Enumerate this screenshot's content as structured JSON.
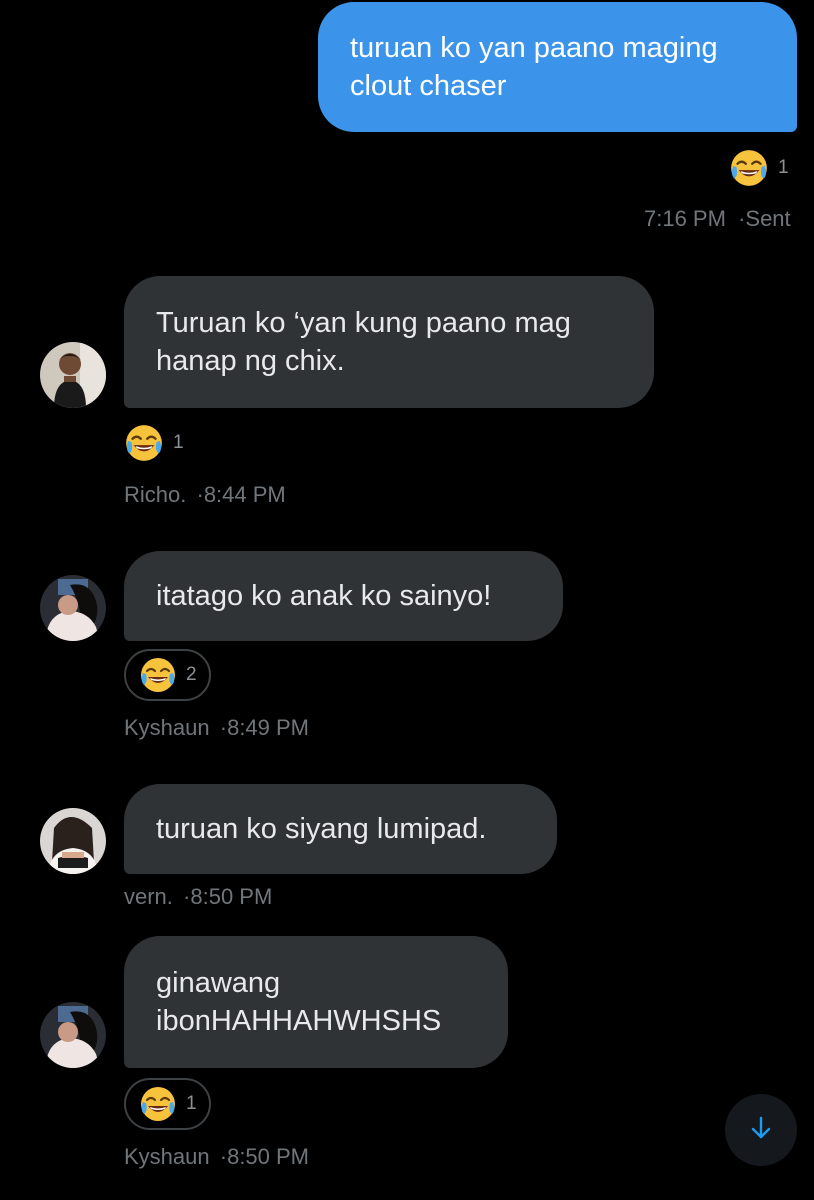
{
  "messages": [
    {
      "text": "turuan ko yan paano maging\nclout chaser",
      "reaction": {
        "emoji": "face-with-tears-of-joy",
        "count": "1"
      },
      "time": "7:16 PM",
      "status": "Sent"
    },
    {
      "text": "Turuan ko ‘yan kung paano mag\nhanap ng chix.",
      "reaction": {
        "emoji": "face-with-tears-of-joy",
        "count": "1"
      },
      "sender": "Richo.",
      "time": "8:44 PM"
    },
    {
      "text": "itatago ko anak ko sainyo!",
      "reaction": {
        "emoji": "face-with-tears-of-joy",
        "count": "2"
      },
      "sender": "Kyshaun",
      "time": "8:49 PM"
    },
    {
      "text": "turuan ko siyang lumipad.",
      "sender": "vern.",
      "time": "8:50 PM"
    },
    {
      "text": "ginawang\nibonHAHHAHWHSHS",
      "reaction": {
        "emoji": "face-with-tears-of-joy",
        "count": "1"
      },
      "sender": "Kyshaun",
      "time": "8:50 PM"
    }
  ],
  "meta_separator": "·",
  "scroll_button": {
    "icon": "arrow-down-icon"
  },
  "colors": {
    "outgoing_bubble": "#3b94e9",
    "incoming_bubble": "#2f3336",
    "background": "#000000",
    "meta_text": "#71767b",
    "accent": "#1d9bf0"
  }
}
